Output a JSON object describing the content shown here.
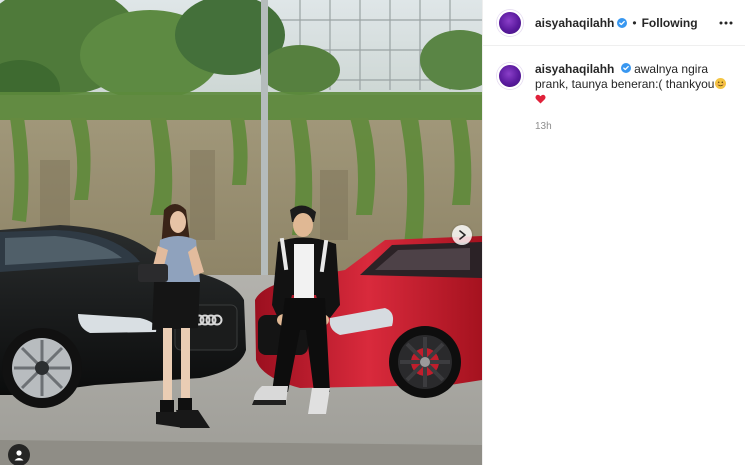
{
  "post": {
    "author": {
      "username": "aisyahaqilahh",
      "verified": true,
      "avatar_color": "#6a23b3"
    },
    "header": {
      "separator": "•",
      "follow_status": "Following",
      "more_icon": "more-horizontal-icon"
    },
    "caption": {
      "text": "awalnya ngira prank, taunya beneran:( thankyou",
      "emojis": [
        "smiling-face-emoji",
        "red-heart-emoji"
      ]
    },
    "timestamp": "13h",
    "media": {
      "next_icon": "chevron-right-icon",
      "tag_icon": "user-tag-icon",
      "car_badge": "Audi",
      "colors": {
        "wall": "#9c9478",
        "ivy": "#5f8a3a",
        "black_car": "#121414",
        "red_car": "#c81b2d",
        "ground": "#a9a8a3"
      }
    }
  }
}
